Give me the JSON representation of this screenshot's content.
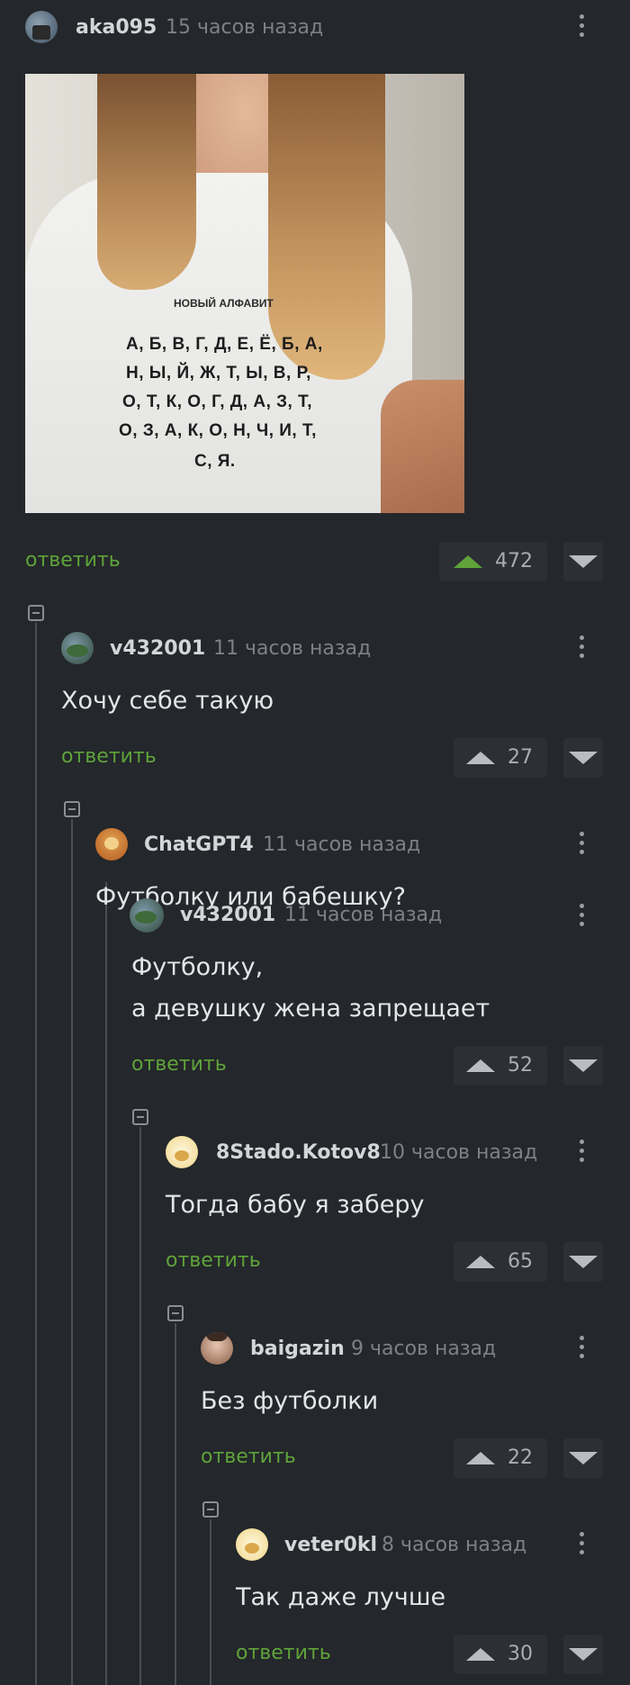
{
  "post": {
    "author": "aka095",
    "time": "15 часов назад",
    "shirt_heading": "НОВЫЙ АЛФАВИТ",
    "shirt_lines": [
      "А, Б, В, Г, Д, Е, Ё, Б, А,",
      "Н, Ы, Й, Ж, Т, Ы, В, Р,",
      "О, Т, К, О, Г, Д, А, З, Т,",
      "О, З, А, К, О, Н, Ч, И, Т,",
      "С, Я."
    ],
    "reply_label": "ответить",
    "votes": "472"
  },
  "comments": [
    {
      "author": "v432001",
      "time": "11 часов назад",
      "text": "Хочу себе такую",
      "reply_label": "ответить",
      "votes": "27"
    },
    {
      "author": "ChatGPT4",
      "time": "11 часов назад",
      "text": "Футболку или бабешку?"
    },
    {
      "author": "v432001",
      "time": "11 часов назад",
      "text_line1": "Футболку,",
      "text_line2": "а девушку жена запрещает",
      "reply_label": "ответить",
      "votes": "52"
    },
    {
      "author": "8Stado.Kotov8",
      "time": "10 часов назад",
      "text": "Тогда бабу я заберу",
      "reply_label": "ответить",
      "votes": "65"
    },
    {
      "author": "baigazin",
      "time": "9 часов назад",
      "text": "Без футболки",
      "reply_label": "ответить",
      "votes": "22"
    },
    {
      "author": "veter0kl",
      "time": "8 часов назад",
      "text": "Так даже лучше",
      "reply_label": "ответить",
      "votes": "30"
    }
  ],
  "colors": {
    "background": "#24272b",
    "reply_green": "#5fa33a",
    "upvote_green": "#5fa33a"
  }
}
